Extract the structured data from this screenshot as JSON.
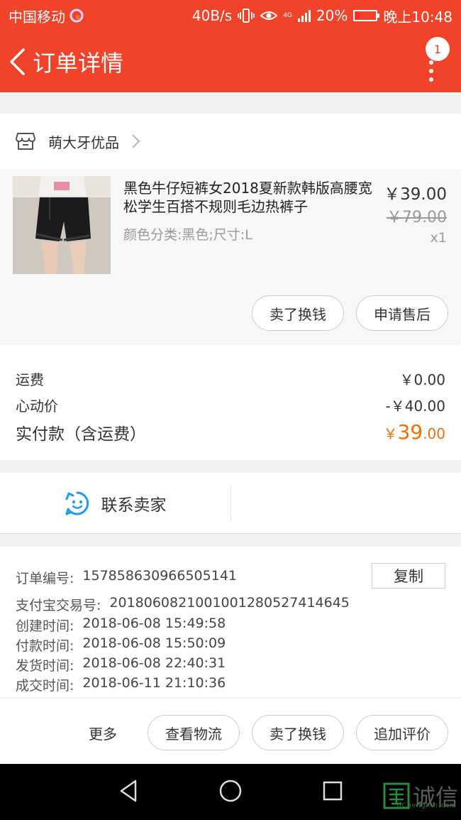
{
  "status_bar": {
    "carrier": "中国移动",
    "network_speed": "40B/s",
    "network_type": "4G",
    "battery": "20%",
    "time": "晚上10:48"
  },
  "header": {
    "title": "订单详情",
    "notification_count": "1"
  },
  "shop": {
    "name": "萌大牙优品"
  },
  "product": {
    "title": "黑色牛仔短裤女2018夏新款韩版高腰宽松学生百搭不规则毛边热裤子",
    "spec": "颜色分类:黑色;尺寸:L",
    "price": "￥39.00",
    "original_price": "￥79.00",
    "quantity": "x1",
    "buttons": [
      "卖了换钱",
      "申请售后"
    ]
  },
  "fees": {
    "shipping_label": "运费",
    "shipping_value": "￥0.00",
    "discount_label": "心动价",
    "discount_value": "-￥40.00",
    "total_label": "实付款（含运费）",
    "total_currency": "￥",
    "total_int": "39",
    "total_dec": ".00"
  },
  "contact": {
    "label": "联系卖家"
  },
  "order_info": {
    "order_no_label": "订单编号:",
    "order_no": "157858630966505141",
    "copy_label": "复制",
    "alipay_label": "支付宝交易号:",
    "alipay_no": "2018060821001001280527414645",
    "created_label": "创建时间:",
    "created": "2018-06-08 15:49:58",
    "paid_label": "付款时间:",
    "paid": "2018-06-08 15:50:09",
    "shipped_label": "发货时间:",
    "shipped": "2018-06-08 22:40:31",
    "completed_label": "成交时间:",
    "completed": "2018-06-11 21:10:36"
  },
  "bottom_actions": {
    "more": "更多",
    "logistics": "查看物流",
    "resell": "卖了换钱",
    "review": "追加评价"
  },
  "watermark": {
    "text": "诚信",
    "sub": "JiChengXin.com"
  },
  "colors": {
    "brand": "#f0432a",
    "price_accent": "#f56d00",
    "contact_icon": "#1e9cf0"
  }
}
